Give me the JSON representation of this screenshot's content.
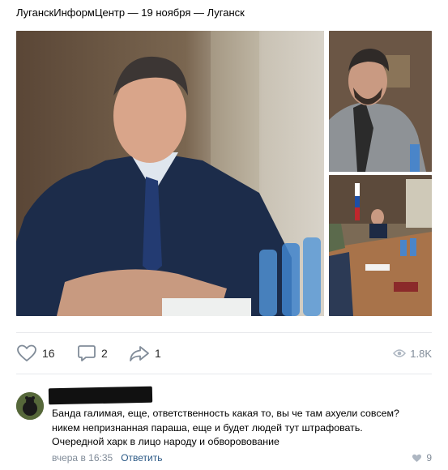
{
  "post": {
    "header": "ЛуганскИнформЦентр — 19 ноября — Луганск"
  },
  "actions": {
    "likes": "16",
    "comments": "2",
    "shares": "1",
    "views": "1.8K",
    "icons": [
      "heart-icon",
      "comment-icon",
      "share-icon",
      "eye-icon"
    ]
  },
  "comment": {
    "lines": [
      "Банда галимая, еще, ответственность какая то, вы че там ахуели совсем?",
      "никем непризнанная параша, еще и будет людей тут штрафовать.",
      "Очередной харк в лицо народу и обворовование"
    ],
    "time": "вчера в 16:35",
    "reply_label": "Ответить",
    "likes": "9"
  },
  "colors": {
    "accent": "#2a5885",
    "muted": "#818c99",
    "divider": "#e7e8ec"
  }
}
